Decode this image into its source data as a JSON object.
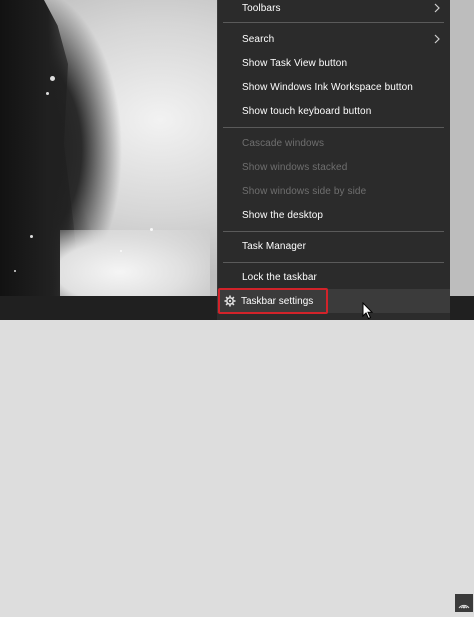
{
  "menu": {
    "items": [
      {
        "label": "Toolbars",
        "disabled": false,
        "submenu": true
      },
      {
        "label": "Search",
        "disabled": false,
        "submenu": true
      },
      {
        "label": "Show Task View button",
        "disabled": false,
        "submenu": false
      },
      {
        "label": "Show Windows Ink Workspace button",
        "disabled": false,
        "submenu": false
      },
      {
        "label": "Show touch keyboard button",
        "disabled": false,
        "submenu": false
      },
      {
        "label": "Cascade windows",
        "disabled": true,
        "submenu": false
      },
      {
        "label": "Show windows stacked",
        "disabled": true,
        "submenu": false
      },
      {
        "label": "Show windows side by side",
        "disabled": true,
        "submenu": false
      },
      {
        "label": "Show the desktop",
        "disabled": false,
        "submenu": false
      },
      {
        "label": "Task Manager",
        "disabled": false,
        "submenu": false
      },
      {
        "label": "Lock the taskbar",
        "disabled": false,
        "submenu": false
      }
    ],
    "settings_label": "Taskbar settings",
    "settings_icon": "gear-icon"
  },
  "colors": {
    "menu_bg": "#2b2b2b",
    "disabled_text": "#6f6f6f",
    "highlight_border": "#d2232a",
    "taskbar_bg": "#202020"
  }
}
